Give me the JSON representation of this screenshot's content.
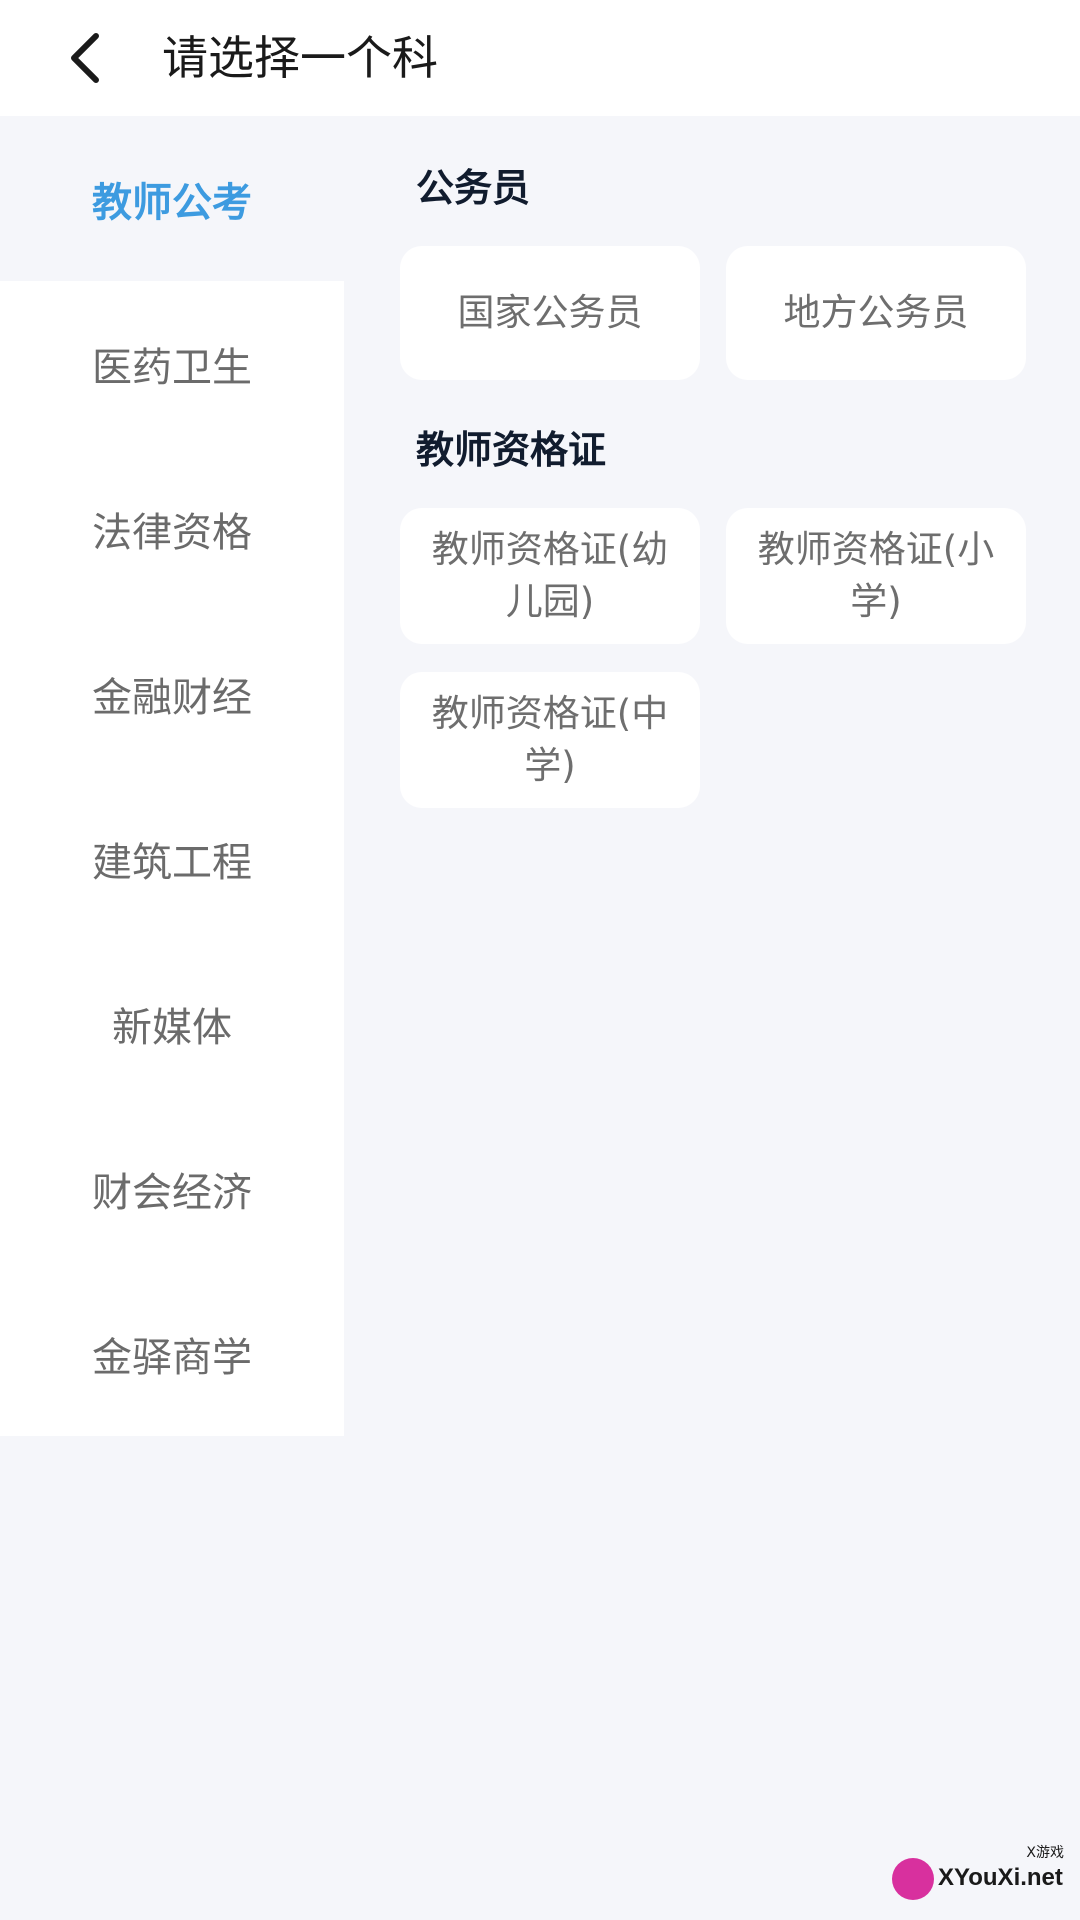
{
  "header": {
    "title": "请选择一个科",
    "back_icon": "chevron-left-icon"
  },
  "sidebar": {
    "items": [
      {
        "label": "教师公考",
        "active": true
      },
      {
        "label": "医药卫生",
        "active": false
      },
      {
        "label": "法律资格",
        "active": false
      },
      {
        "label": "金融财经",
        "active": false
      },
      {
        "label": "建筑工程",
        "active": false
      },
      {
        "label": "新媒体",
        "active": false
      },
      {
        "label": "财会经济",
        "active": false
      },
      {
        "label": "金驿商学",
        "active": false
      }
    ]
  },
  "content": {
    "sections": [
      {
        "title": "公务员",
        "cards": [
          "国家公务员",
          "地方公务员"
        ]
      },
      {
        "title": "教师资格证",
        "cards": [
          "教师资格证(幼儿园)",
          "教师资格证(小学)",
          "教师资格证(中学)"
        ]
      }
    ]
  },
  "watermark": {
    "text": "XYouXi.net",
    "small": "X游戏"
  },
  "colors": {
    "accent": "#3d9be0",
    "background": "#f5f6fa",
    "card": "#ffffff",
    "text_muted": "#6e6e6e",
    "watermark_badge": "#d8309e"
  }
}
